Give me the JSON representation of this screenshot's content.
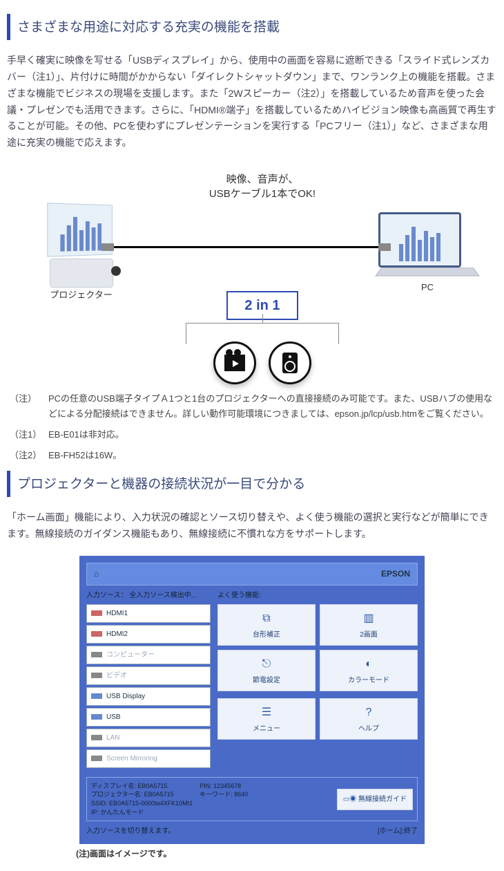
{
  "section1": {
    "title": "さまざまな用途に対応する充実の機能を搭載",
    "paragraph": "手早く確実に映像を写せる「USBディスプレイ」から、使用中の画面を容易に遮断できる「スライド式レンズカバー（注1）」、片付けに時間がかからない「ダイレクトシャットダウン」まで、ワンランク上の機能を搭載。さまざまな機能でビジネスの現場を支援します。また「2Wスピーカー（注2）」を搭載しているため音声を使った会議・プレゼンでも活用できます。さらに、「HDMI®端子」を搭載しているためハイビジョン映像も高画質で再生することが可能。その他、PCを使わずにプレゼンテーションを実行する「PCフリー（注1）」など、さまざまな用途に充実の機能で応えます。"
  },
  "diagram": {
    "top_line1": "映像、音声が、",
    "top_line2": "USBケーブル1本でOK!",
    "projector_label": "プロジェクター",
    "pc_label": "PC",
    "two_in_one": "2 in 1"
  },
  "notes": [
    {
      "label": "（注）",
      "body": "PCの任意のUSB端子タイプＡ1つと1台のプロジェクターへの直接接続のみ可能です。また、USBハブの使用などによる分配接続はできません。詳しい動作可能環境につきましては、epson.jp/lcp/usb.htmをご覧ください。"
    },
    {
      "label": "（注1）",
      "body": "EB-E01は非対応。"
    },
    {
      "label": "（注2）",
      "body": "EB-FH52は16W。"
    }
  ],
  "section2": {
    "title": "プロジェクターと機器の接続状況が一目で分かる",
    "paragraph": "「ホーム画面」機能により、入力状況の確認とソース切り替えや、よく使う機能の選択と実行などが簡単にできます。無線接続のガイダンス機能もあり、無線接続に不慣れな方をサポートします。"
  },
  "home": {
    "brand": "EPSON",
    "src_title": "入力ソース： 全入力ソース検出中...",
    "sources": [
      "HDMI1",
      "HDMI2",
      "コンピューター",
      "ビデオ",
      "USB Display",
      "USB",
      "LAN",
      "Screen Mirroring"
    ],
    "func_title": "よく使う機能:",
    "funcs": [
      "台形補正",
      "2画面",
      "節電設定",
      "カラーモード",
      "メニュー",
      "ヘルプ"
    ],
    "info_left_col1": [
      "ディスプレイ名: EB0A5715",
      "プロジェクター名: EB0A5715",
      "SSID:  EB0A5715-0000ta4XFK10Mt1",
      "IP:  かんたんモード"
    ],
    "info_left_col2": [
      "PIN: 12345678",
      "キーワード: 8640"
    ],
    "wireless_guide": "無線接続ガイド",
    "bottom_left": "入力ソースを切り替えます。",
    "bottom_right": "[ホーム]:終了",
    "caption": "(注)画面はイメージです。"
  }
}
